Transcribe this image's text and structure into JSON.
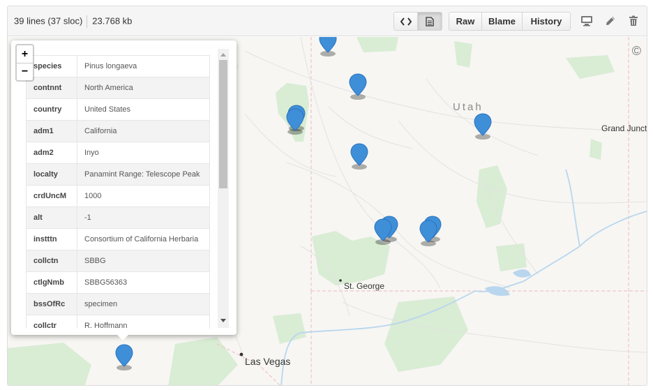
{
  "file_header": {
    "lines": "39 lines (37 sloc)",
    "size": "23.768 kb",
    "view_code_icon": "code-icon",
    "view_rendered_icon": "document-icon",
    "raw_label": "Raw",
    "blame_label": "Blame",
    "history_label": "History",
    "desktop_icon": "desktop-icon",
    "edit_icon": "pencil-icon",
    "delete_icon": "trash-icon"
  },
  "map": {
    "labels": {
      "state": "Utah",
      "city1": "Grand Juncti",
      "city2": "St. George",
      "city3": "Las Vegas"
    },
    "attribution": "©",
    "zoom_in": "+",
    "zoom_out": "−",
    "marker_color": "#3f8fd8"
  },
  "popup": {
    "rows": [
      {
        "key": "species",
        "value": "Pinus longaeva"
      },
      {
        "key": "contnnt",
        "value": "North America"
      },
      {
        "key": "country",
        "value": "United States"
      },
      {
        "key": "adm1",
        "value": "California"
      },
      {
        "key": "adm2",
        "value": "Inyo"
      },
      {
        "key": "localty",
        "value": "Panamint Range: Telescope Peak"
      },
      {
        "key": "crdUncM",
        "value": "1000"
      },
      {
        "key": "alt",
        "value": "-1"
      },
      {
        "key": "instttn",
        "value": "Consortium of California Herbaria"
      },
      {
        "key": "collctn",
        "value": "SBBG"
      },
      {
        "key": "ctlgNmb",
        "value": "SBBG56363"
      },
      {
        "key": "bssOfRc",
        "value": "specimen"
      },
      {
        "key": "collctr",
        "value": "R. Hoffmann"
      }
    ]
  }
}
